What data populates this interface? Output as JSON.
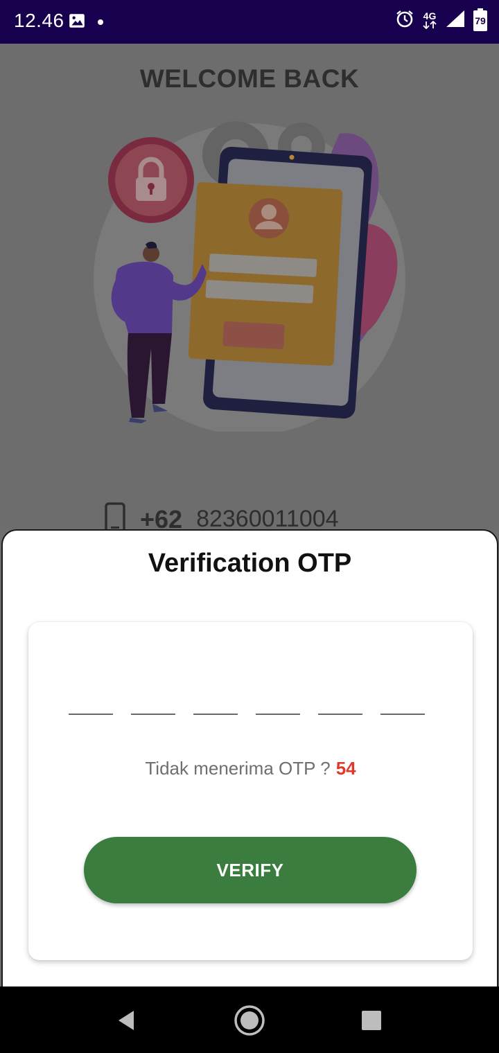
{
  "status_bar": {
    "time": "12.46",
    "network": "4G",
    "battery": "79",
    "icons": [
      "image-icon",
      "dot-icon",
      "alarm-icon",
      "network-arrows-icon",
      "signal-icon",
      "battery-icon"
    ]
  },
  "background": {
    "title": "WELCOME BACK",
    "country_code": "+62",
    "phone_number": "82360011004"
  },
  "sheet": {
    "title": "Verification OTP",
    "otp_slots": [
      "",
      "",
      "",
      "",
      "",
      ""
    ],
    "resend_text": "Tidak menerima OTP ?",
    "countdown": "54",
    "verify_label": "VERIFY"
  },
  "colors": {
    "status_bar": "#17004d",
    "accent_green": "#3a7d3e",
    "countdown_red": "#e0392b",
    "dim_overlay": "#6d6d6d"
  },
  "nav_bar": {
    "buttons": [
      "back-icon",
      "home-icon",
      "recents-icon"
    ]
  }
}
